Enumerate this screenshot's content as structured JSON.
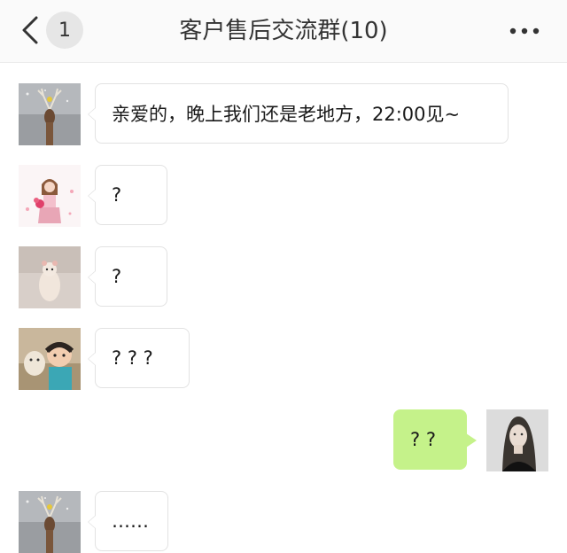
{
  "header": {
    "back_count": "1",
    "title": "客户售后交流群(10)"
  },
  "messages": [
    {
      "side": "left",
      "avatar": "deer-avatar",
      "text": "亲爱的，晚上我们还是老地方，22:00见~"
    },
    {
      "side": "left",
      "avatar": "girl-flowers-avatar",
      "text": "?"
    },
    {
      "side": "left",
      "avatar": "hamster-avatar",
      "text": "?"
    },
    {
      "side": "left",
      "avatar": "boy-dog-avatar",
      "text": "? ? ?"
    },
    {
      "side": "right",
      "avatar": "woman-portrait-avatar",
      "text": "? ?"
    },
    {
      "side": "left",
      "avatar": "deer-avatar",
      "text": "……"
    }
  ],
  "colors": {
    "header_bg": "#fafafa",
    "self_bubble": "#c5f28a",
    "other_bubble": "#ffffff",
    "badge_bg": "#e6e6e6"
  },
  "icons": {
    "back": "chevron-left-icon",
    "more": "more-dots-icon"
  }
}
